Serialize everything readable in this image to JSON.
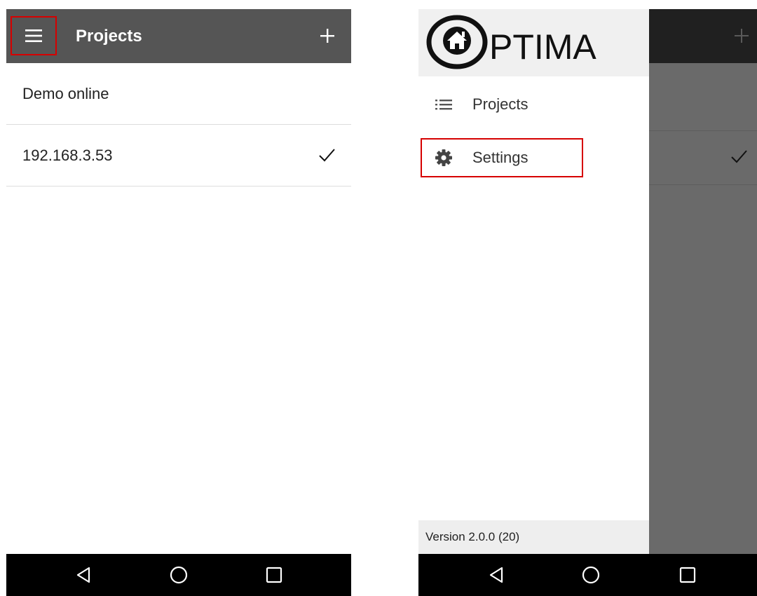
{
  "left_screen": {
    "appbar": {
      "title": "Projects"
    },
    "projects": [
      {
        "name": "Demo online",
        "selected": false
      },
      {
        "name": "192.168.3.53",
        "selected": true
      }
    ]
  },
  "right_screen": {
    "logo": {
      "text": "PTIMA"
    },
    "drawer": {
      "items": [
        {
          "label": "Projects",
          "icon": "list-icon"
        },
        {
          "label": "Settings",
          "icon": "gear-icon"
        }
      ],
      "version": "Version 2.0.0 (20)"
    }
  },
  "colors": {
    "appbar": "#555555",
    "appbar_dimmed": "#202020",
    "highlight": "#d60000",
    "scrim": "#6a6a6a",
    "drawer_header": "#f0f0f0"
  }
}
